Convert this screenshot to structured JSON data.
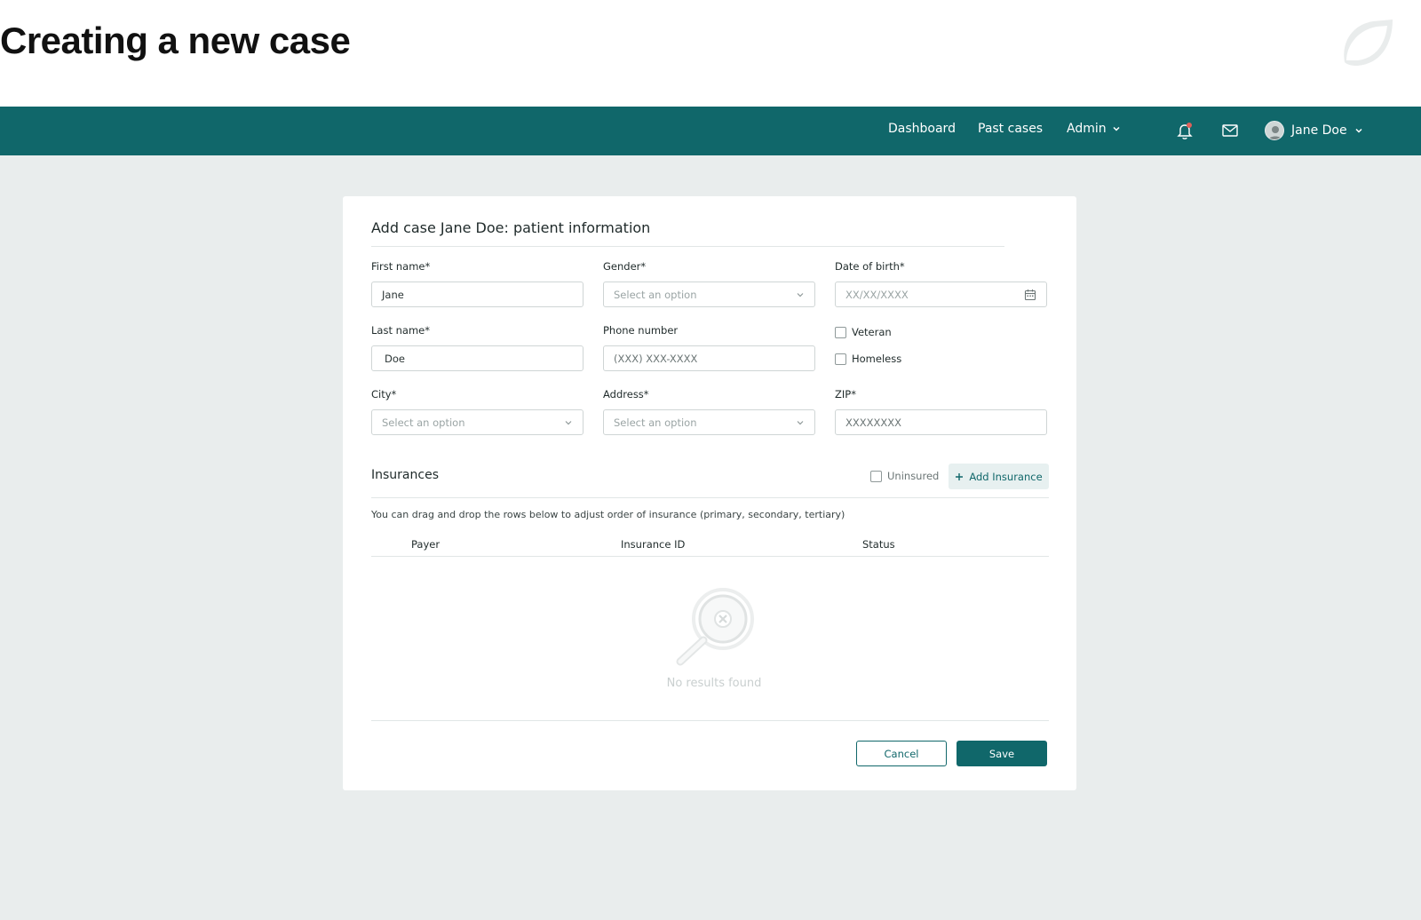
{
  "slide": {
    "title": "Creating a new case"
  },
  "nav": {
    "links": {
      "dashboard": "Dashboard",
      "past_cases": "Past cases",
      "admin": "Admin"
    },
    "user_name": "Jane Doe",
    "notification_dot_color": "#e0605a",
    "bar_color": "#10676a"
  },
  "form": {
    "title": "Add case Jane Doe: patient information",
    "first_name": {
      "label": "First name*",
      "value": "Jane"
    },
    "gender": {
      "label": "Gender*",
      "placeholder": "Select an option"
    },
    "dob": {
      "label": "Date of birth*",
      "placeholder": "XX/XX/XXXX"
    },
    "last_name": {
      "label": "Last name*",
      "value": "Doe"
    },
    "phone": {
      "label": "Phone number",
      "placeholder": "(XXX) XXX-XXXX"
    },
    "veteran": {
      "label": "Veteran"
    },
    "homeless": {
      "label": "Homeless"
    },
    "city": {
      "label": "City*",
      "placeholder": "Select an option"
    },
    "address": {
      "label": "Address*",
      "placeholder": "Select an option"
    },
    "zip": {
      "label": "ZIP*",
      "placeholder": "XXXXXXXX"
    }
  },
  "insurance": {
    "title": "Insurances",
    "uninsured_label": "Uninsured",
    "add_label": "Add Insurance",
    "hint": "You can drag and drop the rows below to adjust order of insurance (primary, secondary, tertiary)",
    "columns": [
      "Payer",
      "Insurance ID",
      "Status"
    ],
    "rows": [],
    "empty_text": "No results found"
  },
  "actions": {
    "cancel": "Cancel",
    "save": "Save"
  },
  "icons": {
    "notification": "bell-icon",
    "mail": "mail-icon",
    "calendar": "calendar-icon",
    "empty": "magnifier-x-icon",
    "add": "plus-icon",
    "dropdown": "chevron-down-icon"
  }
}
